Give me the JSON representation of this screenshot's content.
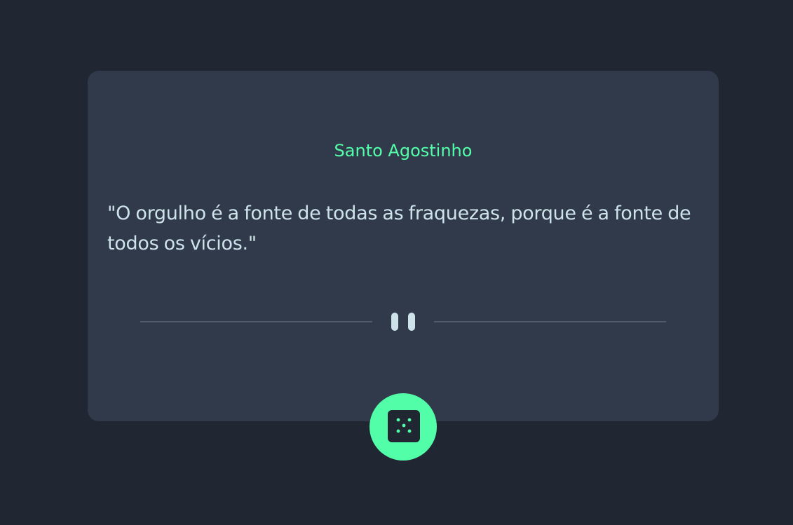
{
  "card": {
    "author": "Santo Agostinho",
    "quote": "\"O orgulho é a fonte de todas as fraquezas, porque é a fonte de todos os vícios.\""
  },
  "icons": {
    "divider": "pause-icon",
    "button": "dice-icon"
  },
  "colors": {
    "background": "#202632",
    "card": "#313a4b",
    "accent": "#52ffa8",
    "text": "#cee3e9",
    "divider_line": "#4f5b6b"
  }
}
